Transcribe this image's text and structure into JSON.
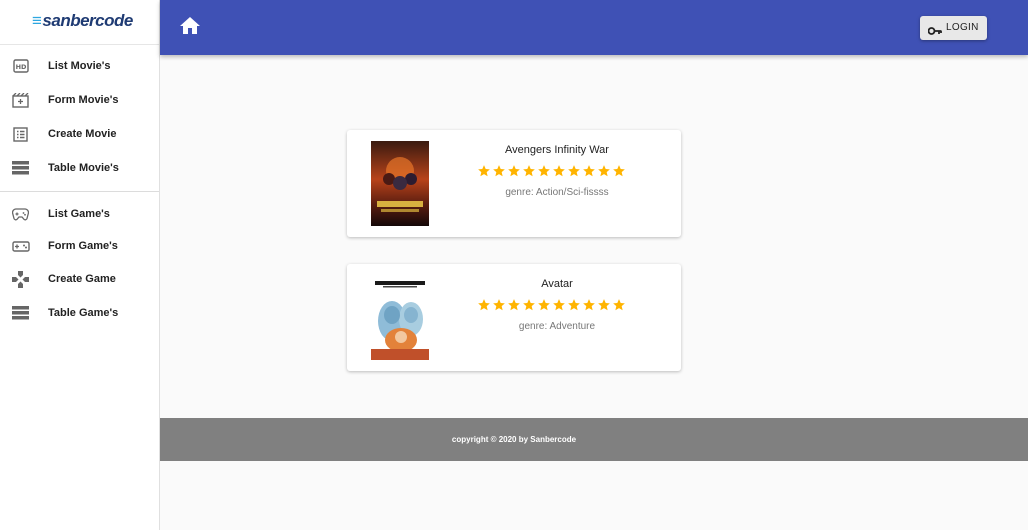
{
  "brand": {
    "name": "sanbercode"
  },
  "sidebar": {
    "movies": [
      {
        "label": "List Movie's",
        "icon": "hd-icon"
      },
      {
        "label": "Form Movie's",
        "icon": "movie-clapper-icon"
      },
      {
        "label": "Create Movie",
        "icon": "list-alt-icon"
      },
      {
        "label": "Table Movie's",
        "icon": "table-rows-icon"
      }
    ],
    "games": [
      {
        "label": "List Game's",
        "icon": "gamepad-icon"
      },
      {
        "label": "Form Game's",
        "icon": "videogame-asset-icon"
      },
      {
        "label": "Create Game",
        "icon": "dpad-icon"
      },
      {
        "label": "Table Game's",
        "icon": "table-rows-icon"
      }
    ]
  },
  "header": {
    "login_label": "LOGIN"
  },
  "movies": [
    {
      "title": "Avengers Infinity War",
      "rating": 10,
      "genre": "genre: Action/Sci-fissss"
    },
    {
      "title": "Avatar",
      "rating": 10,
      "genre": "genre: Adventure"
    }
  ],
  "footer": {
    "text": "copyright © 2020 by Sanbercode"
  },
  "colors": {
    "header": "#3f51b5",
    "star": "#ffb400",
    "footer": "#808080"
  }
}
